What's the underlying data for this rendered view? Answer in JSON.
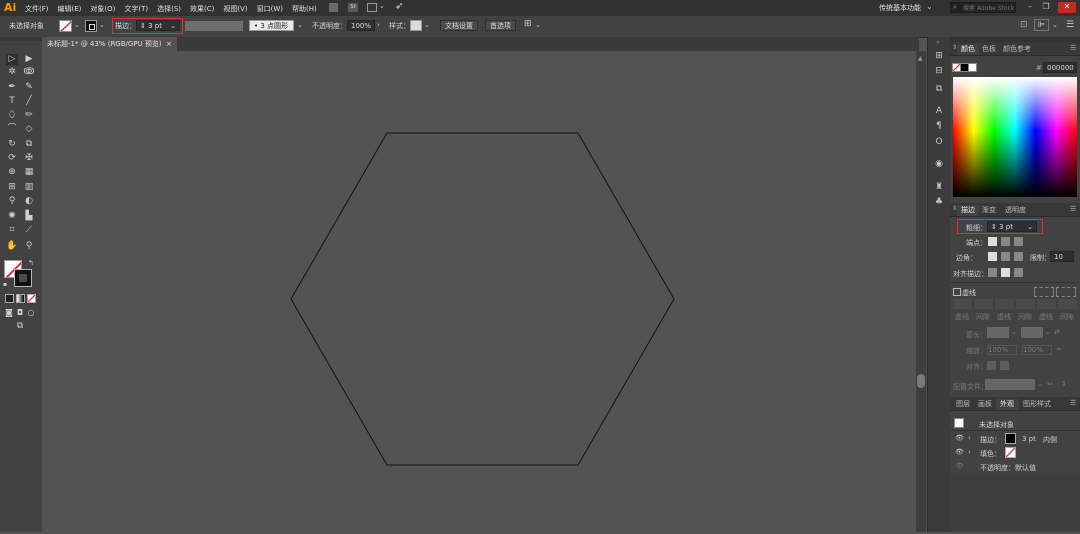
{
  "app": {
    "logo": "Ai"
  },
  "menu": [
    "文件(F)",
    "编辑(E)",
    "对象(O)",
    "文字(T)",
    "选择(S)",
    "效果(C)",
    "视图(V)",
    "窗口(W)",
    "帮助(H)"
  ],
  "menubar": {
    "br_label": "Br",
    "st_label": "St",
    "workspace": "传统基本功能",
    "stock_placeholder": "搜索 Adobe Stock"
  },
  "control": {
    "selection": "未选择对象",
    "stroke_label": "描边：",
    "stroke_value": "3 pt",
    "brush_value": "3 点圆形",
    "opacity_label": "不透明度：",
    "opacity_value": "100%",
    "style_label": "样式：",
    "doc_setup": "文档设置",
    "preferences": "首选项"
  },
  "document": {
    "tab_title": "未标题-1* @ 43% (RGB/GPU 预览)",
    "close": "×"
  },
  "color_panel": {
    "tabs": [
      "颜色",
      "色板",
      "颜色参考"
    ],
    "hex": "000000",
    "fill_color": "#ffffff",
    "stroke_color": "#000000"
  },
  "stroke_panel": {
    "tabs": [
      "描边",
      "渐变",
      "透明度"
    ],
    "weight_label": "粗细：",
    "weight_value": "3 pt",
    "cap_label": "端点：",
    "corner_label": "边角：",
    "limit_label": "限制：",
    "limit_value": "10",
    "align_label": "对齐描边：",
    "dashed_label": "虚线",
    "dash_cells": [
      "虚线",
      "间隙",
      "虚线",
      "间隙",
      "虚线",
      "间隙"
    ],
    "arrow_label": "箭头：",
    "scale_label": "缩放：",
    "scale_1": "100%",
    "scale_2": "100%",
    "align_arrow_label": "对齐：",
    "profile_label": "配置文件："
  },
  "appearance_panel": {
    "tabs": [
      "图层",
      "画板",
      "外观",
      "图形样式"
    ],
    "title": "未选择对象",
    "stroke_row": "描边：",
    "stroke_weight": "3 pt",
    "stroke_pos": "内侧",
    "fill_row": "填色：",
    "opacity_row": "不透明度：默认值"
  },
  "colors": {
    "accent_red": "#e03030",
    "canvas": "#535353",
    "ui": "#424242",
    "menubar": "#323232"
  }
}
